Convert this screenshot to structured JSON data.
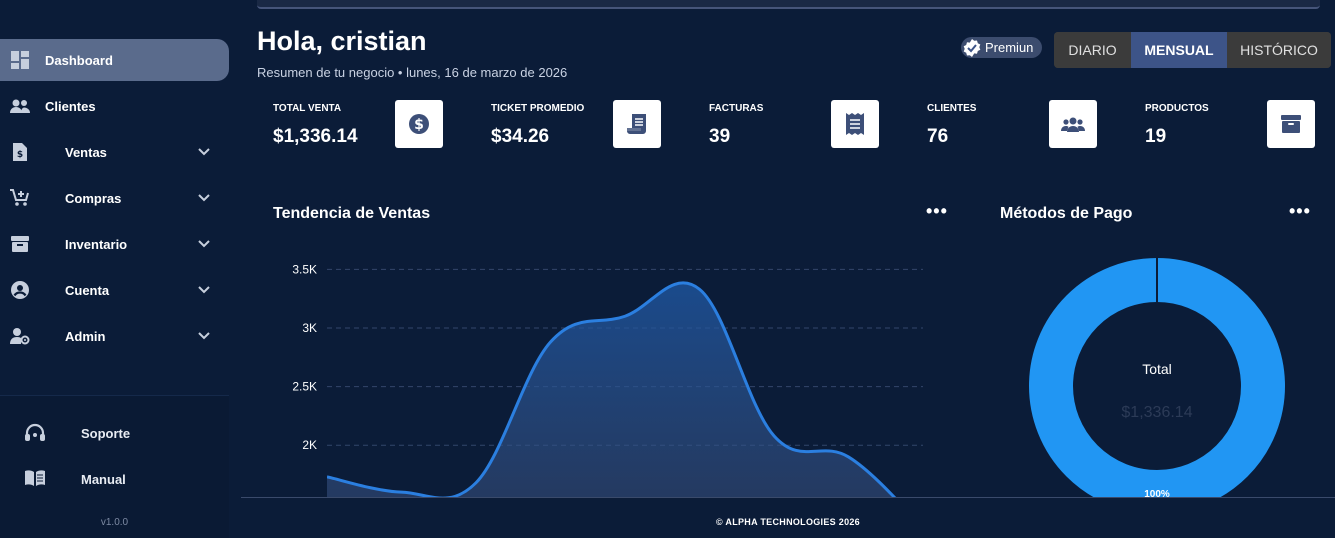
{
  "sidebar": {
    "items": [
      {
        "label": "Dashboard",
        "icon": "dashboard-icon",
        "active": true
      },
      {
        "label": "Clientes",
        "icon": "users-icon"
      },
      {
        "label": "Ventas",
        "icon": "invoice-dollar-icon"
      },
      {
        "label": "Compras",
        "icon": "cart-plus-icon"
      },
      {
        "label": "Inventario",
        "icon": "archive-box-icon"
      },
      {
        "label": "Cuenta",
        "icon": "user-circle-icon"
      },
      {
        "label": "Admin",
        "icon": "user-cog-icon"
      }
    ],
    "bottom": [
      {
        "label": "Soporte",
        "icon": "headset-icon"
      },
      {
        "label": "Manual",
        "icon": "book-open-icon"
      }
    ],
    "version": "v1.0.0"
  },
  "header": {
    "greeting": "Hola, cristian",
    "subtitle": "Resumen de tu negocio • lunes, 16 de marzo de 2026",
    "premium": "Premiun",
    "tabs": [
      "DIARIO",
      "MENSUAL",
      "HISTÓRICO"
    ],
    "active_tab": "MENSUAL"
  },
  "stats": [
    {
      "label": "TOTAL VENTA",
      "value": "$1,336.14",
      "icon": "dollar-circle-icon"
    },
    {
      "label": "TICKET PROMEDIO",
      "value": "$34.26",
      "icon": "receipt-icon"
    },
    {
      "label": "FACTURAS",
      "value": "39",
      "icon": "invoice-icon"
    },
    {
      "label": "CLIENTES",
      "value": "76",
      "icon": "users-group-icon"
    },
    {
      "label": "PRODUCTOS",
      "value": "19",
      "icon": "archive-icon"
    }
  ],
  "colors": {
    "background": "#0b1c38",
    "accent": "#3d5488",
    "line": "#2b7fe0",
    "donut": "#2196f3",
    "icon_fg": "#3d4f78"
  },
  "sales_panel": {
    "title": "Tendencia de Ventas",
    "menu": "•••"
  },
  "payment_panel": {
    "title": "Métodos de Pago",
    "menu": "•••",
    "center_label": "Total",
    "center_value": "$1,336.14"
  },
  "chart_data": [
    {
      "type": "area",
      "title": "Tendencia de Ventas",
      "y_ticks": [
        "2K",
        "2.5K",
        "3K",
        "3.5K"
      ],
      "y_tick_values": [
        2000,
        2500,
        3000,
        3500
      ],
      "ylim": [
        1550,
        3750
      ],
      "grid": true,
      "x": [
        0,
        1,
        2,
        3,
        4,
        5,
        6,
        7,
        8
      ],
      "values": [
        1730,
        1600,
        1680,
        2880,
        3100,
        3330,
        2080,
        1900,
        1300
      ]
    },
    {
      "type": "pie",
      "title": "Métodos de Pago",
      "slices": [
        {
          "value": 100,
          "label": "100%"
        }
      ]
    }
  ],
  "footer": "© ALPHA TECHNOLOGIES 2026"
}
